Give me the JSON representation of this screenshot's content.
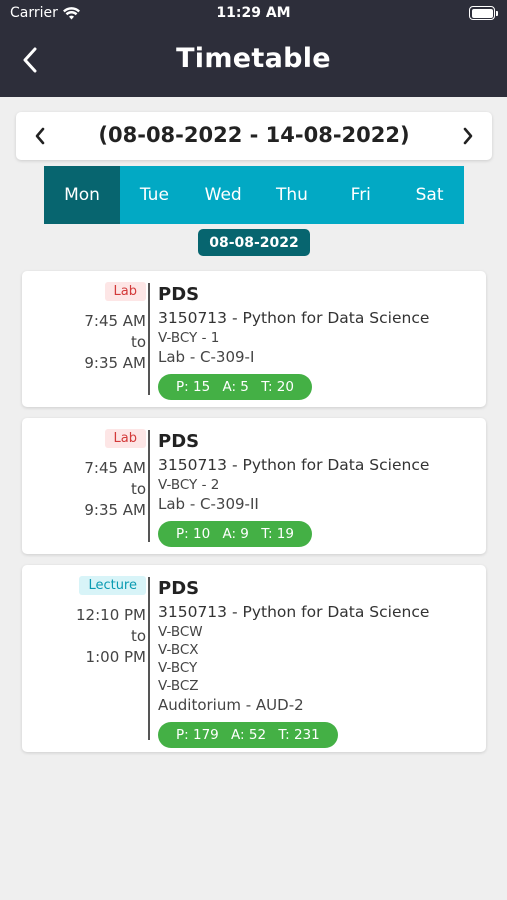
{
  "status_bar": {
    "carrier": "Carrier",
    "time": "11:29 AM"
  },
  "header": {
    "title": "Timetable"
  },
  "week": {
    "range": "(08-08-2022 - 14-08-2022)"
  },
  "days": [
    {
      "label": "Mon",
      "active": true
    },
    {
      "label": "Tue",
      "active": false
    },
    {
      "label": "Wed",
      "active": false
    },
    {
      "label": "Thu",
      "active": false
    },
    {
      "label": "Fri",
      "active": false
    },
    {
      "label": "Sat",
      "active": false
    }
  ],
  "selected_date": "08-08-2022",
  "sessions": [
    {
      "type": "Lab",
      "start": "7:45 AM",
      "to": "to",
      "end": "9:35 AM",
      "code": "PDS",
      "subject": "3150713 - Python for Data Science",
      "batches": [
        "V-BCY - 1"
      ],
      "venue": "Lab - C-309-I",
      "present": "P: 15",
      "absent": "A: 5",
      "total": "T: 20"
    },
    {
      "type": "Lab",
      "start": "7:45 AM",
      "to": "to",
      "end": "9:35 AM",
      "code": "PDS",
      "subject": "3150713 - Python for Data Science",
      "batches": [
        "V-BCY - 2"
      ],
      "venue": "Lab - C-309-II",
      "present": "P: 10",
      "absent": "A: 9",
      "total": "T: 19"
    },
    {
      "type": "Lecture",
      "start": "12:10 PM",
      "to": "to",
      "end": "1:00 PM",
      "code": "PDS",
      "subject": "3150713 - Python for Data Science",
      "batches": [
        "V-BCW",
        "V-BCX",
        "V-BCY",
        "V-BCZ"
      ],
      "venue": "Auditorium - AUD-2",
      "present": "P: 179",
      "absent": "A: 52",
      "total": "T: 231"
    }
  ],
  "colors": {
    "header_bg": "#2d2e3a",
    "tab_bg": "#02a9c4",
    "tab_active": "#07656f",
    "attendance_green": "#44b045",
    "lab_badge_text": "#d33a3a",
    "lecture_badge_text": "#0a9bb2"
  }
}
